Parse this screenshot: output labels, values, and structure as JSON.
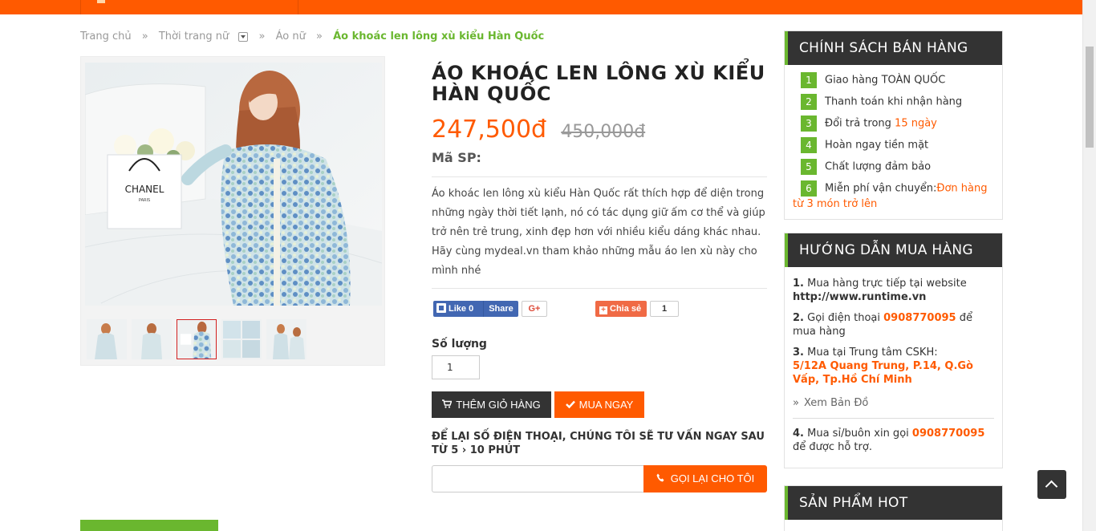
{
  "breadcrumb": {
    "home": "Trang chủ",
    "category": "Thời trang nữ",
    "subcategory": "Áo nữ",
    "current": "Áo khoác len lông xù kiểu Hàn Quốc"
  },
  "gallery": {
    "bag_brand": "CHANEL",
    "bag_sub": "PARIS",
    "thumbs": [
      "thumb-1",
      "thumb-2",
      "thumb-3",
      "thumb-4",
      "thumb-5"
    ],
    "active_thumb_index": 2
  },
  "product": {
    "title": "ÁO KHOÁC LEN LÔNG XÙ KIỂU HÀN QUỐC",
    "price": "247,500đ",
    "old_price": "450,000đ",
    "sku_label": "Mã SP:",
    "description": "Áo khoác len lông xù kiểu Hàn Quốc rất thích hợp để diện trong những ngày thời tiết lạnh, nó có tác dụng giữ ấm cơ thể và giúp trở nên trẻ trung, xinh đẹp hơn với nhiều kiểu dáng khác nhau. Hãy cùng mydeal.vn tham khảo những mẫu áo len xù này cho mình nhé"
  },
  "social": {
    "like_label": "Like 0",
    "share_label": "Share",
    "gplus_label": "G+",
    "chiase_label": "Chia sẻ",
    "chiase_count": "1"
  },
  "purchase": {
    "qty_label": "Số lượng",
    "qty_value": "1",
    "add_cart_label": "THÊM GIỎ HÀNG",
    "buy_now_label": "MUA NGAY",
    "callback_title": "ĐỂ LẠI SỐ ĐIỆN THOẠI, CHÚNG TÔI SẼ TƯ VẤN NGAY SAU TỪ 5 › 10 PHÚT",
    "callback_placeholder": "",
    "callback_button": "GỌI LẠI CHO TÔI"
  },
  "sidebar": {
    "policy_title": "CHÍNH SÁCH BÁN HÀNG",
    "policy_items": [
      {
        "num": "1",
        "text": "Giao hàng TOÀN QUỐC",
        "highlight": ""
      },
      {
        "num": "2",
        "text": "Thanh toán khi nhận hàng",
        "highlight": ""
      },
      {
        "num": "3",
        "text": "Đổi trả trong ",
        "highlight": "15 ngày"
      },
      {
        "num": "4",
        "text": "Hoàn ngay tiền mặt",
        "highlight": ""
      },
      {
        "num": "5",
        "text": "Chất lượng đảm bảo",
        "highlight": ""
      },
      {
        "num": "6",
        "text": "Miễn phí vận chuyển:",
        "highlight": "Đơn hàng từ 3 món trở lên"
      }
    ],
    "guide_title": "HƯỚNG DẪN MUA HÀNG",
    "guide": {
      "item1_num": "1.",
      "item1_text": "Mua hàng trực tiếp tại website",
      "item1_url": "http://www.runtime.vn",
      "item2_num": "2.",
      "item2_pre": "Gọi điện thoại",
      "item2_phone": "0908770095",
      "item2_post": "để mua hàng",
      "item3_num": "3.",
      "item3_text": "Mua tại Trung tâm CSKH:",
      "item3_addr": "5/12A Quang Trung, P.14, Q.Gò Vấp, Tp.Hồ Chí Minh",
      "map_link": "Xem Bản Đồ",
      "item4_num": "4.",
      "item4_pre": "Mua sỉ/buôn xin gọi",
      "item4_phone": "0908770095",
      "item4_post": "để được hỗ trợ."
    },
    "hot_title": "SẢN PHẨM HOT"
  },
  "colors": {
    "accent_orange": "#ff5a00",
    "accent_green": "#6ab72f",
    "dark": "#333333"
  }
}
